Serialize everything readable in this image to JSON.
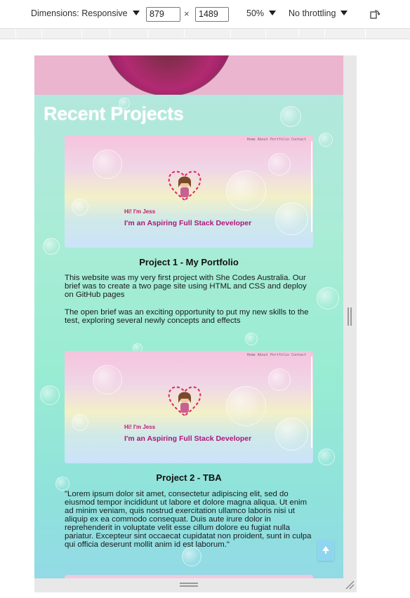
{
  "toolbar": {
    "dimensions_label": "Dimensions: Responsive",
    "width_value": "879",
    "times_sign": "×",
    "height_value": "1489",
    "zoom_label": "50%",
    "throttling_label": "No throttling",
    "rotate_icon": "rotate-icon"
  },
  "page": {
    "section_title": "Recent Projects",
    "projects": [
      {
        "image_nav": "Home  About  Portfolio  Contact",
        "image_greeting": "Hi! I'm Jess",
        "image_subtitle": "I'm an Aspiring Full Stack Developer",
        "title": "Project 1 - My Portfolio",
        "paragraph_1": "This website was my very first project with She Codes Australia. Our brief was to create a two page site using HTML and CSS and deploy on GitHub pages",
        "paragraph_2": "The open brief was an exciting opportunity to put my new skills to the test, exploring several newly concepts and effects"
      },
      {
        "image_nav": "Home  About  Portfolio  Contact",
        "image_greeting": "Hi! I'm Jess",
        "image_subtitle": "I'm an Aspiring Full Stack Developer",
        "title": "Project 2 - TBA",
        "paragraph_1": "\"Lorem ipsum dolor sit amet, consectetur adipiscing elit, sed do eiusmod tempor incididunt ut labore et dolore magna aliqua. Ut enim ad minim veniam, quis nostrud exercitation ullamco laboris nisi ut aliquip ex ea commodo consequat. Duis aute irure dolor in reprehenderit in voluptate velit esse cillum dolore eu fugiat nulla pariatur. Excepteur sint occaecat cupidatat non proident, sunt in culpa qui officia deserunt mollit anim id est laborum.\""
      }
    ],
    "back_to_top_icon": "arrow-up-icon"
  },
  "colors": {
    "header_pink": "#ebb4cf",
    "accent_magenta": "#c0187a",
    "background_mint": "#a9ecd6"
  }
}
